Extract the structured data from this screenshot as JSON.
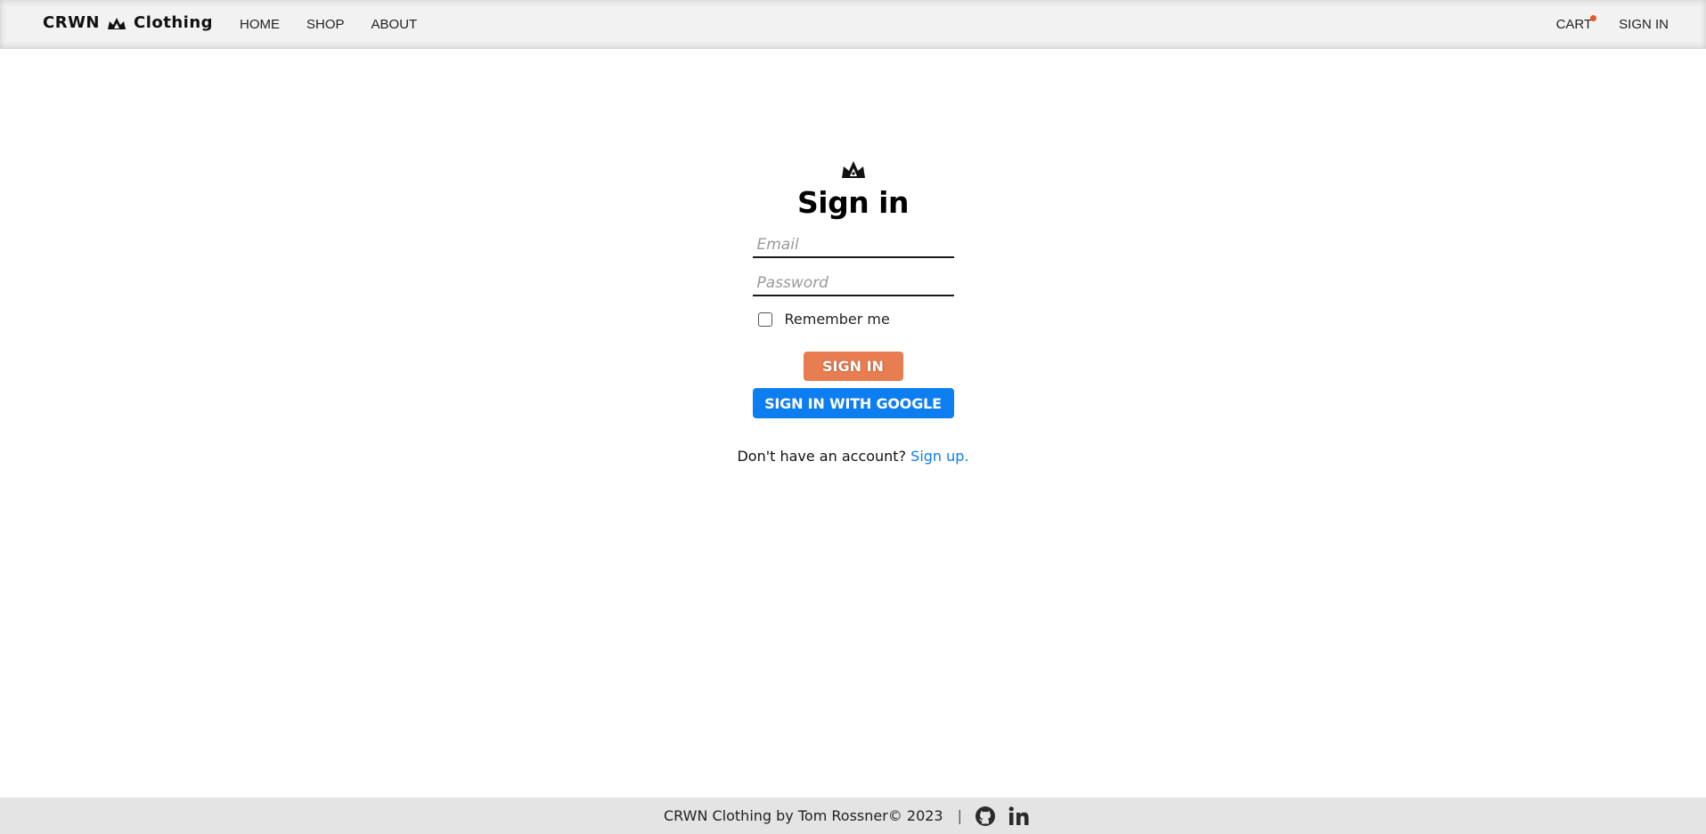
{
  "header": {
    "brand_left": "CRWN",
    "brand_right": "Clothing",
    "nav": [
      "HOME",
      "SHOP",
      "ABOUT"
    ],
    "cart_label": "CART",
    "signin_label": "SIGN IN",
    "cart_indicator_color": "#e8552a"
  },
  "signin": {
    "title": "Sign in",
    "email_placeholder": "Email",
    "password_placeholder": "Password",
    "remember_label": "Remember me",
    "remember_checked": false,
    "submit_label": "SIGN IN",
    "google_label": "SIGN IN WITH GOOGLE",
    "no_account_text": "Don't have an account?",
    "signup_link": "Sign up",
    "signup_suffix": "."
  },
  "footer": {
    "credit": "CRWN Clothing by Tom Rossner© 2023",
    "separator": "|",
    "icons": [
      "github-icon",
      "linkedin-icon"
    ]
  },
  "colors": {
    "signin_button": "#e97d52",
    "google_button": "#0d7ef0",
    "link": "#0d7ef0",
    "footer_bg": "#e4e4e4",
    "header_bg": "#f2f2f2"
  }
}
